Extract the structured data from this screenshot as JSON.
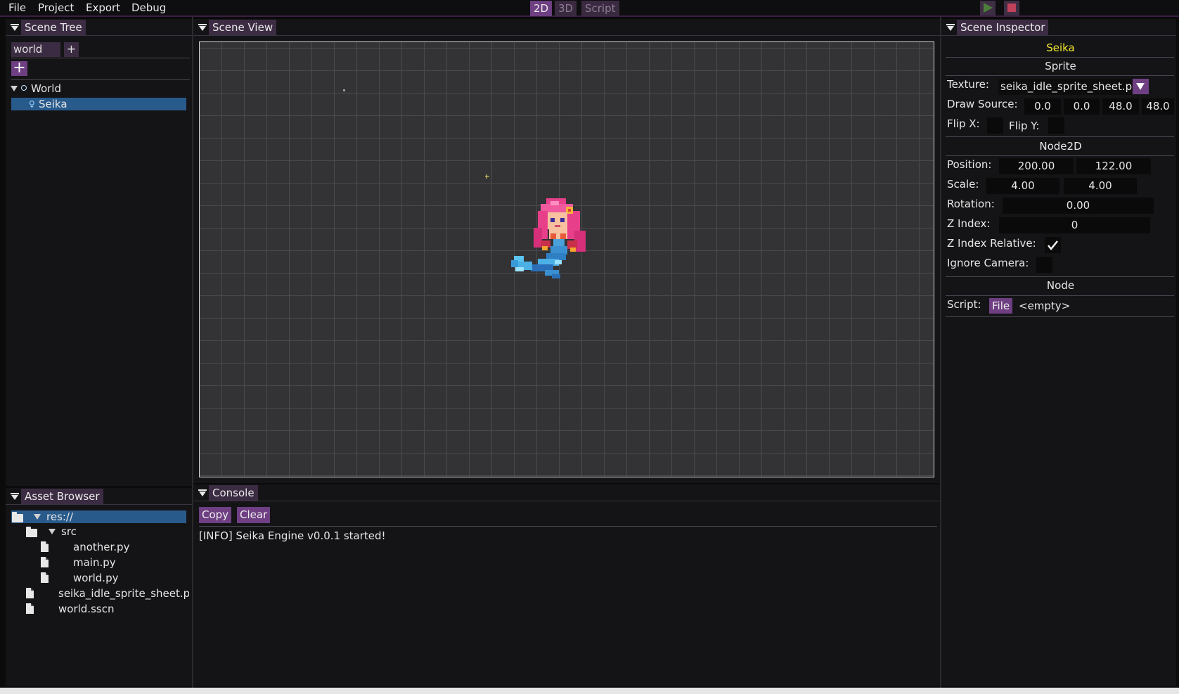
{
  "menu": {
    "file": "File",
    "project": "Project",
    "export": "Export",
    "debug": "Debug"
  },
  "modes": {
    "two_d": "2D",
    "three_d": "3D",
    "script": "Script",
    "active": "2D"
  },
  "scene_tree": {
    "title": "Scene Tree",
    "tab": "world",
    "add_tab": "+",
    "add_node": "+",
    "nodes": [
      {
        "name": "World",
        "icon": "circle-node-icon",
        "expanded": true
      },
      {
        "name": "Seika",
        "icon": "sprite-node-icon",
        "selected": true
      }
    ]
  },
  "scene_view": {
    "title": "Scene View"
  },
  "asset_browser": {
    "title": "Asset Browser",
    "items": [
      {
        "name": "res://",
        "type": "folder",
        "selected": true
      },
      {
        "name": "src",
        "type": "folder"
      },
      {
        "name": "another.py",
        "type": "file"
      },
      {
        "name": "main.py",
        "type": "file"
      },
      {
        "name": "world.py",
        "type": "file"
      },
      {
        "name": "seika_idle_sprite_sheet.p",
        "type": "file"
      },
      {
        "name": "world.sscn",
        "type": "file"
      }
    ]
  },
  "console": {
    "title": "Console",
    "copy_label": "Copy",
    "clear_label": "Clear",
    "lines": [
      "[INFO] Seika Engine v0.0.1 started!"
    ]
  },
  "inspector": {
    "title": "Scene Inspector",
    "node_name": "Seika",
    "node_name_color": "#f5e830",
    "sprite": {
      "header": "Sprite",
      "texture_label": "Texture:",
      "texture_value": "seika_idle_sprite_sheet.p",
      "draw_source_label": "Draw Source:",
      "draw_source": [
        "0.0",
        "0.0",
        "48.0",
        "48.0"
      ],
      "flip_x_label": "Flip X:",
      "flip_y_label": "Flip Y:",
      "flip_x": false,
      "flip_y": false
    },
    "node2d": {
      "header": "Node2D",
      "position_label": "Position:",
      "position": [
        "200.00",
        "122.00"
      ],
      "scale_label": "Scale:",
      "scale": [
        "4.00",
        "4.00"
      ],
      "rotation_label": "Rotation:",
      "rotation": "0.00",
      "z_index_label": "Z Index:",
      "z_index": "0",
      "z_index_relative_label": "Z Index Relative:",
      "z_index_relative": true,
      "ignore_camera_label": "Ignore Camera:",
      "ignore_camera": false
    },
    "node": {
      "header": "Node",
      "script_label": "Script:",
      "file_button": "File",
      "script_value": "<empty>"
    }
  },
  "colors": {
    "accent": "#6e3f82",
    "selection": "#285a8c",
    "viewport_bg": "#333335",
    "grid": "#4a4a4c"
  }
}
